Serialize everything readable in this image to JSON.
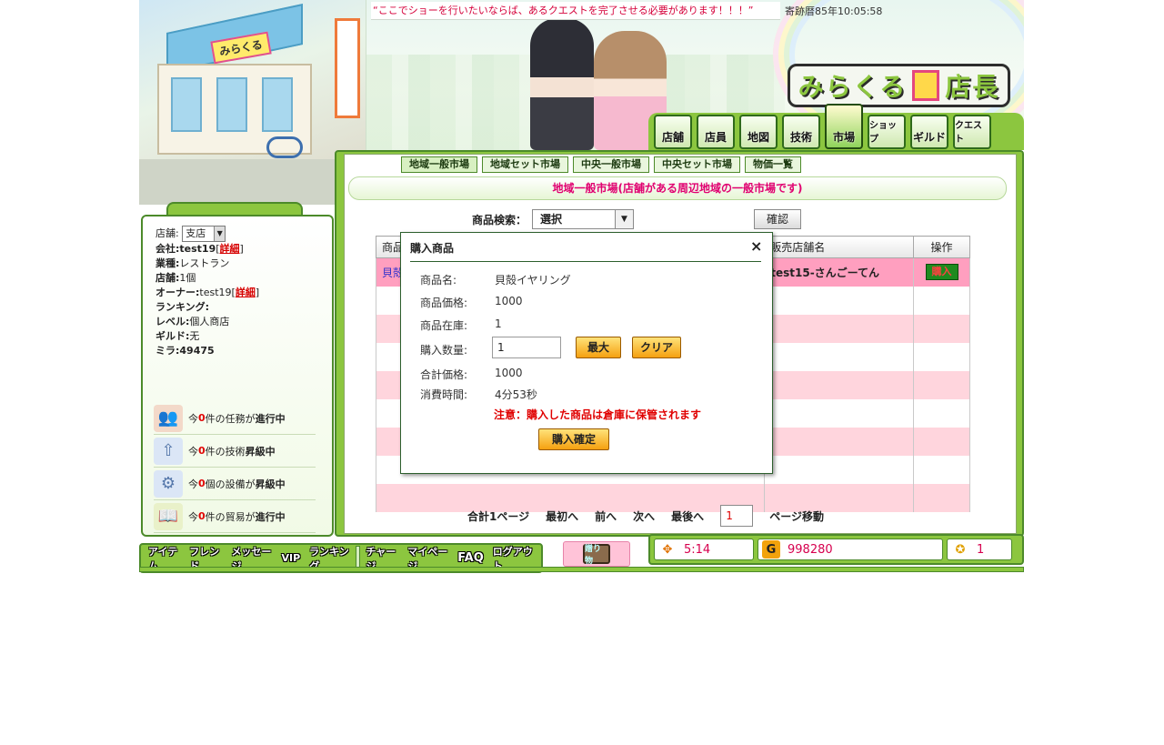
{
  "header": {
    "quote": "“ここでショーを行いたいならば、あるクエストを完了させる必要があります！！！”",
    "clock": "寄跡暦85年10:05:58",
    "brand": "みらくる店長",
    "store_logo": "みらくる",
    "nav": [
      {
        "label": "店舗",
        "icon": "store-icon"
      },
      {
        "label": "店員",
        "icon": "staff-icon"
      },
      {
        "label": "地図",
        "icon": "map-icon"
      },
      {
        "label": "技術",
        "icon": "tech-icon"
      },
      {
        "label": "市場",
        "icon": "market-icon",
        "active": true
      },
      {
        "label": "ショップ",
        "icon": "shop-icon"
      },
      {
        "label": "ギルド",
        "icon": "guild-icon"
      },
      {
        "label": "クエスト",
        "icon": "quest-icon"
      }
    ]
  },
  "left": {
    "branch_label": "店舗:",
    "branch_value": "支店",
    "company_label": "会社:",
    "company_value": "test19",
    "detail_link": "詳細",
    "industry_label": "業種:",
    "industry_value": "レストラン",
    "stores_label": "店舗:",
    "stores_value": "1個",
    "owner_label": "オーナー:",
    "owner_value": "test19",
    "ranking_label": "ランキング:",
    "level_label": "レベル:",
    "level_value": "個人商店",
    "guild_label": "ギルド:",
    "guild_value": "无",
    "mira_label": "ミラ:",
    "mira_value": "49475",
    "status": [
      {
        "pre": "今",
        "num": "0",
        "mid": "件の任務が",
        "bold": "進行中",
        "icon": "people-icon"
      },
      {
        "pre": "今",
        "num": "0",
        "mid": "件の技術",
        "bold": "昇級中",
        "icon": "upgrade-icon"
      },
      {
        "pre": "今",
        "num": "0",
        "mid": "個の設備が",
        "bold": "昇級中",
        "icon": "gear-icon"
      },
      {
        "pre": "今",
        "num": "0",
        "mid": "件の貿易が",
        "bold": "進行中",
        "icon": "book-icon"
      }
    ]
  },
  "market": {
    "subtabs": [
      "地域一般市場",
      "地域セット市場",
      "中央一般市場",
      "中央セット市場",
      "物価一覧"
    ],
    "title": "地域一般市場(店舗がある周辺地域の一般市場です)",
    "search_label": "商品検索：",
    "search_value": "選択",
    "confirm_btn": "確認",
    "columns": [
      "商品名",
      "販売店舗名",
      "操作"
    ],
    "first_row_item": "貝殻",
    "first_row_shop": "test15-さんごーてん",
    "first_row_action": "購入",
    "pager": {
      "total": "合計1ページ",
      "first": "最初へ",
      "prev": "前へ",
      "next": "次へ",
      "last": "最後へ",
      "page": "1",
      "move": "ページ移動"
    }
  },
  "modal": {
    "title": "購入商品",
    "name_label": "商品名:",
    "name_value": "貝殻イヤリング",
    "price_label": "商品価格:",
    "price_value": "1000",
    "stock_label": "商品在庫:",
    "stock_value": "1",
    "qty_label": "購入数量:",
    "qty_value": "1",
    "max_btn": "最大",
    "clear_btn": "クリア",
    "total_label": "合計価格:",
    "total_value": "1000",
    "time_label": "消費時間:",
    "time_value": "4分53秒",
    "notice": "注意：購入した商品は倉庫に保管されます",
    "confirm_btn": "購入確定"
  },
  "bottom": {
    "left_buttons": [
      "アイテム",
      "フレンド",
      "メッセージ",
      "VIP",
      "ランキング"
    ],
    "right_buttons": [
      "チャージ",
      "マイページ",
      "FAQ",
      "ログアウト"
    ],
    "gift_label": "贈り物",
    "time_value": "5:14",
    "gold_value": "998280",
    "ticket_value": "1"
  }
}
